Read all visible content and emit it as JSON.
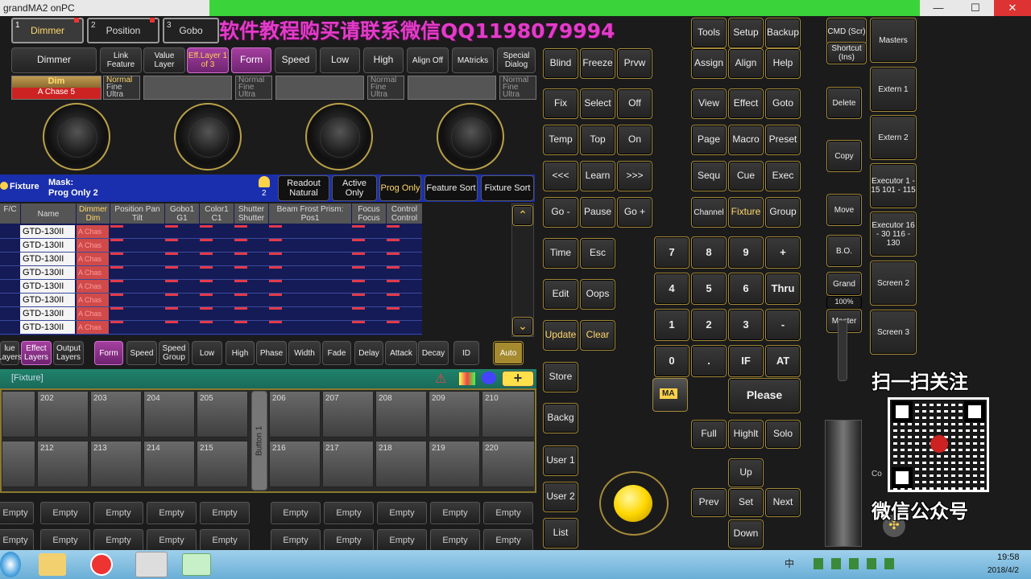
{
  "window": {
    "title": "grandMA2 onPC",
    "min": "—",
    "max": "☐",
    "close": "✕"
  },
  "watermark": "软件教程购买请联系微信QQ1198079994",
  "top_tabs": [
    {
      "num": "1",
      "label": "Dimmer"
    },
    {
      "num": "2",
      "label": "Position"
    },
    {
      "num": "3",
      "label": "Gobo"
    }
  ],
  "attr_buttons": [
    "Dimmer",
    "Link Feature",
    "Value Layer",
    "Eff.Layer 1 of 3",
    "Form",
    "Speed",
    "Low",
    "High",
    "Align Off",
    "MAtricks",
    "Special Dialog"
  ],
  "encoder_labels": {
    "dim": "Dim",
    "chase": "A Chase 5",
    "normal": "Normal",
    "fine": "Fine",
    "ultra": "Ultra"
  },
  "fixture_header": {
    "title": "Fixture",
    "mask_label": "Mask:",
    "mask_value": "Prog Only 2",
    "lock_count": "2",
    "buttons": [
      "Readout Natural",
      "Active Only",
      "Prog Only",
      "Feature Sort",
      "Fixture Sort"
    ]
  },
  "table": {
    "headers": [
      "F/C",
      "Name",
      "Dimmer Dim",
      "Position Pan   Tilt",
      "Gobo1 G1",
      "Color1 C1",
      "Shutter Shutter",
      "Beam Frost Prism: Pos1",
      "Focus Focus",
      "Control Control"
    ],
    "rows": [
      "GTD-130II",
      "GTD-130II",
      "GTD-130II",
      "GTD-130II",
      "GTD-130II",
      "GTD-130II",
      "GTD-130II",
      "GTD-130II"
    ],
    "dim_value": "A Chas"
  },
  "layer_bar": [
    "lue Layers",
    "Effect Layers",
    "Output Layers",
    "Form",
    "Speed",
    "Speed Group",
    "Low",
    "High",
    "Phase",
    "Width",
    "Fade",
    "Delay",
    "Attack",
    "Decay",
    "ID",
    "Auto"
  ],
  "exec_title": "[Fixture]",
  "exec_row1": [
    "202",
    "203",
    "204",
    "205",
    "206",
    "207",
    "208",
    "209",
    "210"
  ],
  "exec_row2": [
    "212",
    "213",
    "214",
    "215",
    "216",
    "217",
    "218",
    "219",
    "220"
  ],
  "button1": "Button 1",
  "empty": "Empty",
  "keys_left": [
    "Blind",
    "Freeze",
    "Prvw",
    "Fix",
    "Select",
    "Off",
    "Temp",
    "Top",
    "On",
    "<<<",
    "Learn",
    ">>>",
    "Go -",
    "Pause",
    "Go +",
    "Time",
    "Esc",
    "Edit",
    "Oops",
    "Update",
    "Clear",
    "Store",
    "Backg",
    "User 1",
    "User 2",
    "List"
  ],
  "keys_right": [
    "Tools",
    "Setup",
    "Backup",
    "Assign",
    "Align",
    "Help",
    "View",
    "Effect",
    "Goto",
    "Page",
    "Macro",
    "Preset",
    "Sequ",
    "Cue",
    "Exec",
    "Channel",
    "Fixture",
    "Group"
  ],
  "numpad": [
    "7",
    "8",
    "9",
    "+",
    "4",
    "5",
    "6",
    "Thru",
    "1",
    "2",
    "3",
    "-",
    "0",
    ".",
    "IF",
    "AT"
  ],
  "please": "Please",
  "ma_logo": "MA",
  "bottom_keys": [
    "Full",
    "Highlt",
    "Solo",
    "Up",
    "Prev",
    "Set",
    "Next",
    "Down"
  ],
  "side_keys": [
    "CMD (Scr)",
    "Shortcut (Ins)",
    "Delete",
    "Copy",
    "Move",
    "B.O.",
    "Grand",
    "100%",
    "Master"
  ],
  "masters": [
    "Masters",
    "Extern 1",
    "Extern 2",
    "Executor 1 - 15 101 - 115",
    "Executor 16 - 30 116 - 130",
    "Screen 2",
    "Screen 3"
  ],
  "qr": {
    "top": "扫一扫关注",
    "bottom": "微信公众号"
  },
  "clock": {
    "time": "19:58",
    "date": "2018/4/2"
  },
  "tray": "中",
  "co": "Co"
}
